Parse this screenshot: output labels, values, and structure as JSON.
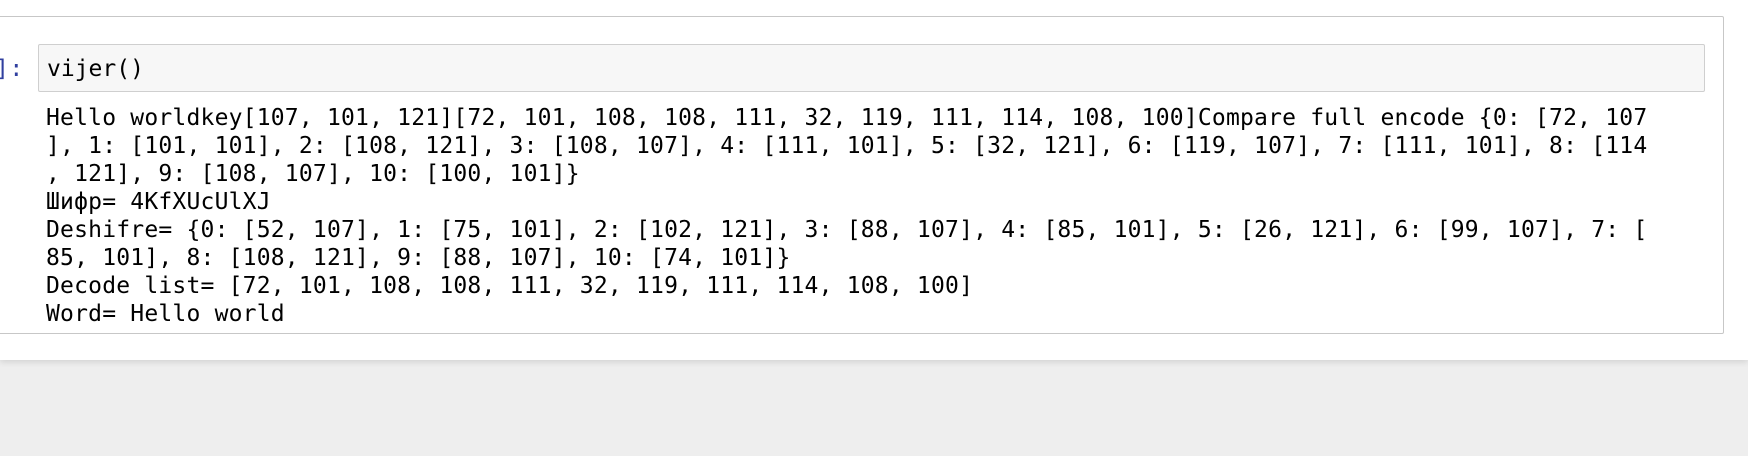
{
  "cell": {
    "prompt": "]:",
    "input_code": "vijer()",
    "output_lines": [
      "Hello worldkey[107, 101, 121][72, 101, 108, 108, 111, 32, 119, 111, 114, 108, 100]Compare full encode {0: [72, 107",
      "], 1: [101, 101], 2: [108, 121], 3: [108, 107], 4: [111, 101], 5: [32, 121], 6: [119, 107], 7: [111, 101], 8: [114",
      ", 121], 9: [108, 107], 10: [100, 101]}",
      "Шифр= 4KfXUcUlXJ",
      "Deshifre= {0: [52, 107], 1: [75, 101], 2: [102, 121], 3: [88, 107], 4: [85, 101], 5: [26, 121], 6: [99, 107], 7: [",
      "85, 101], 8: [108, 121], 9: [88, 107], 10: [74, 101]}",
      "Decode list= [72, 101, 108, 108, 111, 32, 119, 111, 114, 108, 100]",
      "Word= Hello world"
    ]
  },
  "colors": {
    "prompt": "#303f9f",
    "page_background": "#eeeeee",
    "cell_border": "#c7c7c7",
    "input_background": "#f7f7f7"
  }
}
